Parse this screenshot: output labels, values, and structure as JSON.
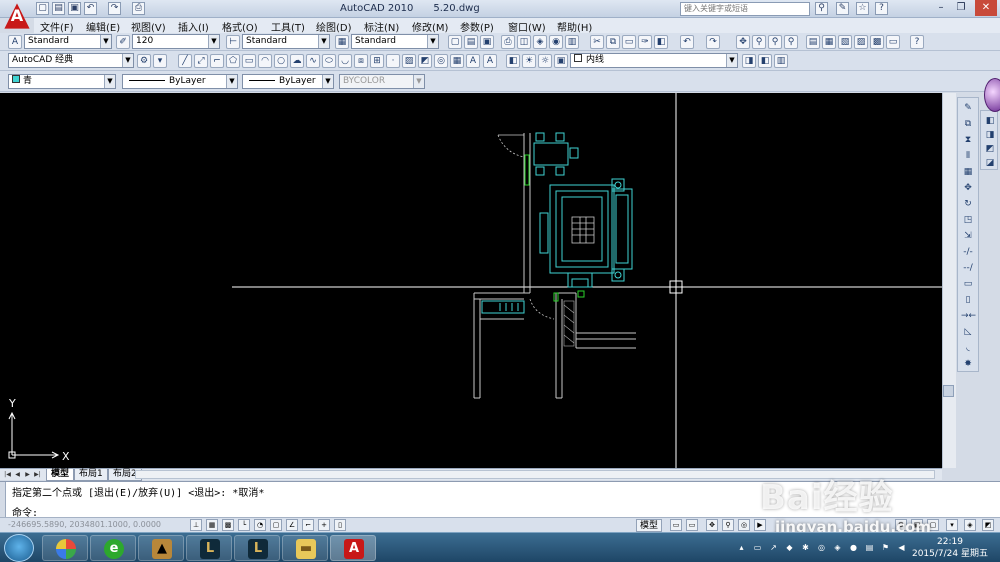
{
  "window": {
    "app_title": "AutoCAD 2010",
    "file_name": "5.20.dwg",
    "search_placeholder": "键入关键字或短语"
  },
  "menu": [
    "文件(F)",
    "编辑(E)",
    "视图(V)",
    "插入(I)",
    "格式(O)",
    "工具(T)",
    "绘图(D)",
    "标注(N)",
    "修改(M)",
    "参数(P)",
    "窗口(W)",
    "帮助(H)"
  ],
  "toolbar1": {
    "text_style": "Standard",
    "dim_scale": "120",
    "dim_style": "Standard",
    "table_style": "Standard"
  },
  "toolbar2": {
    "workspace": "AutoCAD 经典",
    "layer": "内线"
  },
  "toolbar3": {
    "color": "青",
    "linetype": "ByLayer",
    "lineweight": "ByLayer",
    "plot_style": "BYCOLOR"
  },
  "layout_tabs": [
    "模型",
    "布局1",
    "布局2"
  ],
  "command": {
    "line1": "指定第二个点或 [退出(E)/放弃(U)] <退出>:  *取消*",
    "line2": "命令:"
  },
  "status": {
    "coords": "-246695.5890, 2034801.1000, 0.0000",
    "model_label": "模型"
  },
  "ucs": {
    "x_label": "X",
    "y_label": "Y"
  },
  "watermark": {
    "brand": "Bai经验",
    "url": "jingyan.baidu.com"
  },
  "taskbar": {
    "time": "22:19",
    "date": "2015/7/24 星期五"
  },
  "colors": {
    "canvas": "#000000",
    "cyan_lines": "#3fd3d3",
    "white_lines": "#ffffff",
    "green_lines": "#2bd32b"
  }
}
